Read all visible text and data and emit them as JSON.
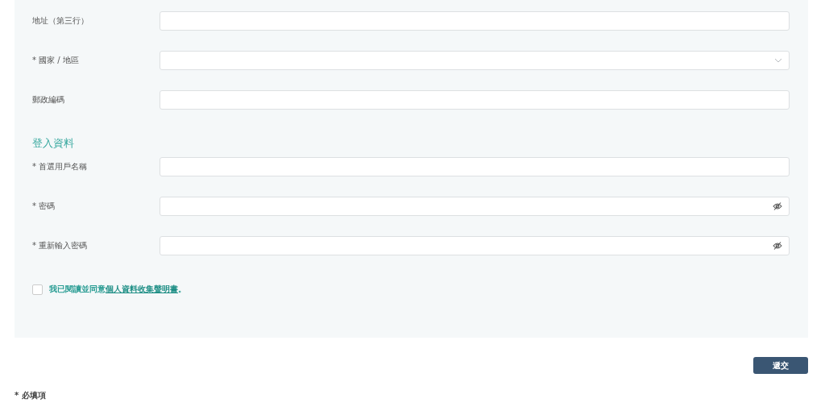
{
  "address_fields": [
    {
      "kind": "text",
      "label": "地址（第三行）"
    },
    {
      "kind": "select",
      "label": "* 國家 / 地區"
    },
    {
      "kind": "text",
      "label": "郵政編碼"
    }
  ],
  "login_section": {
    "title": "登入資料",
    "fields": [
      {
        "kind": "text",
        "label": "* 首選用戶名稱"
      },
      {
        "kind": "password",
        "label": "* 密碼"
      },
      {
        "kind": "password",
        "label": "* 重新輸入密碼"
      }
    ]
  },
  "consent": {
    "checked": false,
    "text": "我已閱讀並同意",
    "link": "個人資料收集聲明書",
    "end": "。"
  },
  "submit_button": "遞交",
  "required_note": "* 必填項"
}
